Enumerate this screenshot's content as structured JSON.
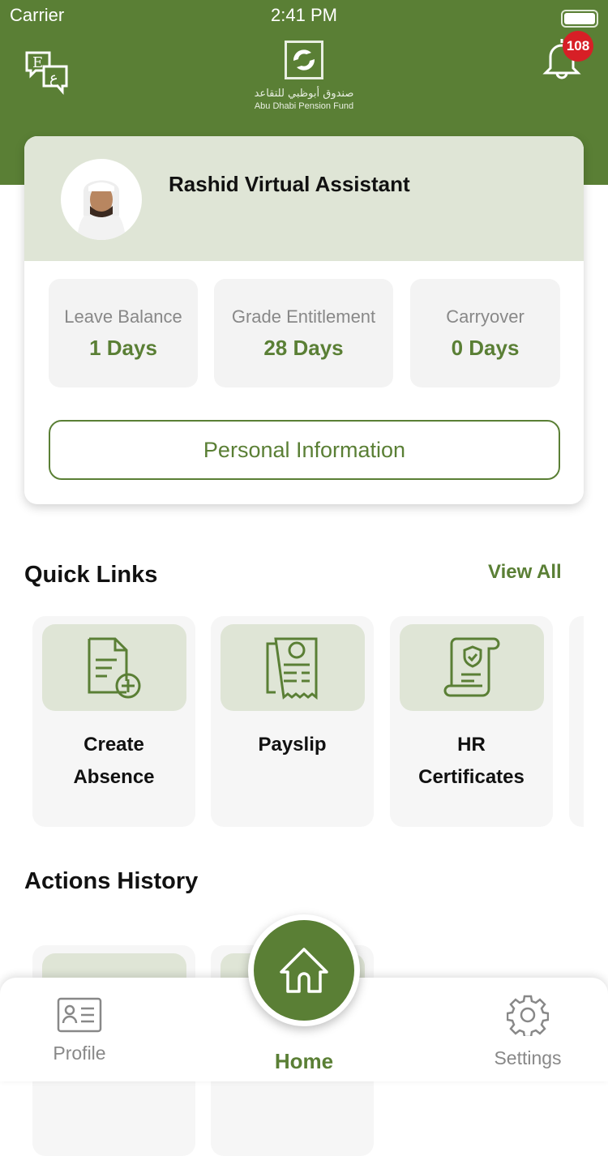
{
  "status": {
    "carrier": "Carrier",
    "time": "2:41 PM"
  },
  "header": {
    "logo_ar": "صندوق أبوظبي للتقاعد",
    "logo_en": "Abu Dhabi Pension Fund",
    "notifications": "108"
  },
  "card": {
    "title": "Rashid Virtual Assistant",
    "stats": [
      {
        "label": "Leave Balance",
        "value": "1 Days"
      },
      {
        "label": "Grade Entitlement",
        "value": "28 Days"
      },
      {
        "label": "Carryover",
        "value": "0 Days"
      }
    ],
    "button": "Personal Information"
  },
  "quick_links": {
    "title": "Quick Links",
    "view_all": "View All",
    "items": [
      {
        "line1": "Create",
        "line2": "Absence",
        "icon": "document-add-icon"
      },
      {
        "line1": "Payslip",
        "line2": "",
        "icon": "payslip-icon"
      },
      {
        "line1": "HR",
        "line2": "Certificates",
        "icon": "certificate-icon"
      }
    ]
  },
  "actions_history": {
    "title": "Actions History"
  },
  "tabbar": {
    "profile": "Profile",
    "home": "Home",
    "settings": "Settings"
  },
  "colors": {
    "brand": "#5a7f35",
    "badge": "#d71f26"
  }
}
